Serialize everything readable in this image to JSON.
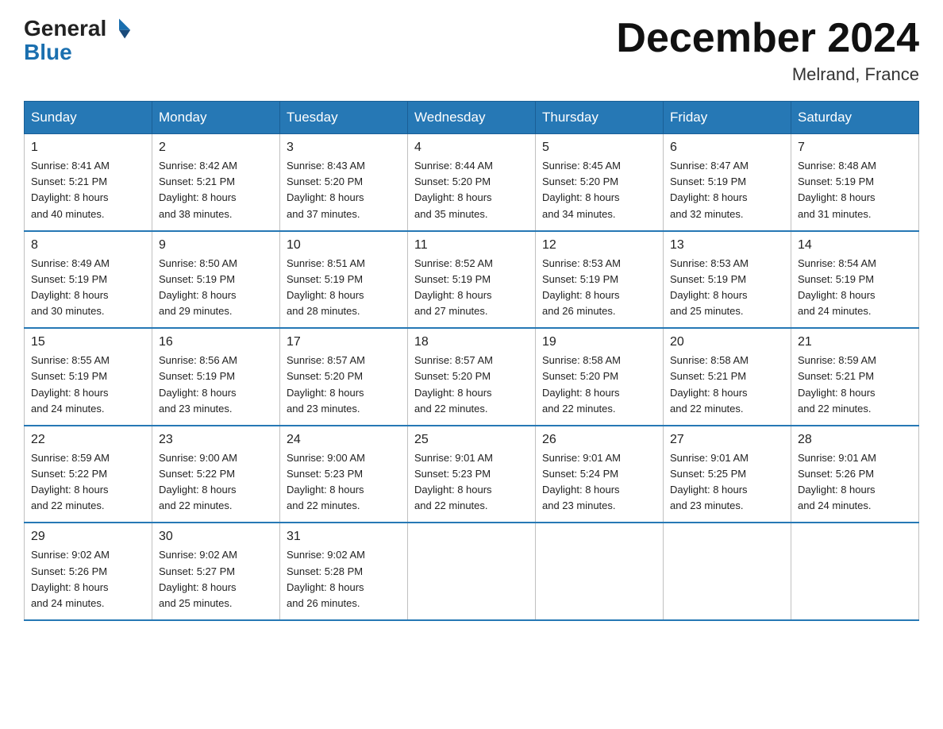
{
  "logo": {
    "general": "General",
    "blue": "Blue"
  },
  "title": "December 2024",
  "location": "Melrand, France",
  "days_of_week": [
    "Sunday",
    "Monday",
    "Tuesday",
    "Wednesday",
    "Thursday",
    "Friday",
    "Saturday"
  ],
  "weeks": [
    [
      {
        "day": "1",
        "info": "Sunrise: 8:41 AM\nSunset: 5:21 PM\nDaylight: 8 hours\nand 40 minutes."
      },
      {
        "day": "2",
        "info": "Sunrise: 8:42 AM\nSunset: 5:21 PM\nDaylight: 8 hours\nand 38 minutes."
      },
      {
        "day": "3",
        "info": "Sunrise: 8:43 AM\nSunset: 5:20 PM\nDaylight: 8 hours\nand 37 minutes."
      },
      {
        "day": "4",
        "info": "Sunrise: 8:44 AM\nSunset: 5:20 PM\nDaylight: 8 hours\nand 35 minutes."
      },
      {
        "day": "5",
        "info": "Sunrise: 8:45 AM\nSunset: 5:20 PM\nDaylight: 8 hours\nand 34 minutes."
      },
      {
        "day": "6",
        "info": "Sunrise: 8:47 AM\nSunset: 5:19 PM\nDaylight: 8 hours\nand 32 minutes."
      },
      {
        "day": "7",
        "info": "Sunrise: 8:48 AM\nSunset: 5:19 PM\nDaylight: 8 hours\nand 31 minutes."
      }
    ],
    [
      {
        "day": "8",
        "info": "Sunrise: 8:49 AM\nSunset: 5:19 PM\nDaylight: 8 hours\nand 30 minutes."
      },
      {
        "day": "9",
        "info": "Sunrise: 8:50 AM\nSunset: 5:19 PM\nDaylight: 8 hours\nand 29 minutes."
      },
      {
        "day": "10",
        "info": "Sunrise: 8:51 AM\nSunset: 5:19 PM\nDaylight: 8 hours\nand 28 minutes."
      },
      {
        "day": "11",
        "info": "Sunrise: 8:52 AM\nSunset: 5:19 PM\nDaylight: 8 hours\nand 27 minutes."
      },
      {
        "day": "12",
        "info": "Sunrise: 8:53 AM\nSunset: 5:19 PM\nDaylight: 8 hours\nand 26 minutes."
      },
      {
        "day": "13",
        "info": "Sunrise: 8:53 AM\nSunset: 5:19 PM\nDaylight: 8 hours\nand 25 minutes."
      },
      {
        "day": "14",
        "info": "Sunrise: 8:54 AM\nSunset: 5:19 PM\nDaylight: 8 hours\nand 24 minutes."
      }
    ],
    [
      {
        "day": "15",
        "info": "Sunrise: 8:55 AM\nSunset: 5:19 PM\nDaylight: 8 hours\nand 24 minutes."
      },
      {
        "day": "16",
        "info": "Sunrise: 8:56 AM\nSunset: 5:19 PM\nDaylight: 8 hours\nand 23 minutes."
      },
      {
        "day": "17",
        "info": "Sunrise: 8:57 AM\nSunset: 5:20 PM\nDaylight: 8 hours\nand 23 minutes."
      },
      {
        "day": "18",
        "info": "Sunrise: 8:57 AM\nSunset: 5:20 PM\nDaylight: 8 hours\nand 22 minutes."
      },
      {
        "day": "19",
        "info": "Sunrise: 8:58 AM\nSunset: 5:20 PM\nDaylight: 8 hours\nand 22 minutes."
      },
      {
        "day": "20",
        "info": "Sunrise: 8:58 AM\nSunset: 5:21 PM\nDaylight: 8 hours\nand 22 minutes."
      },
      {
        "day": "21",
        "info": "Sunrise: 8:59 AM\nSunset: 5:21 PM\nDaylight: 8 hours\nand 22 minutes."
      }
    ],
    [
      {
        "day": "22",
        "info": "Sunrise: 8:59 AM\nSunset: 5:22 PM\nDaylight: 8 hours\nand 22 minutes."
      },
      {
        "day": "23",
        "info": "Sunrise: 9:00 AM\nSunset: 5:22 PM\nDaylight: 8 hours\nand 22 minutes."
      },
      {
        "day": "24",
        "info": "Sunrise: 9:00 AM\nSunset: 5:23 PM\nDaylight: 8 hours\nand 22 minutes."
      },
      {
        "day": "25",
        "info": "Sunrise: 9:01 AM\nSunset: 5:23 PM\nDaylight: 8 hours\nand 22 minutes."
      },
      {
        "day": "26",
        "info": "Sunrise: 9:01 AM\nSunset: 5:24 PM\nDaylight: 8 hours\nand 23 minutes."
      },
      {
        "day": "27",
        "info": "Sunrise: 9:01 AM\nSunset: 5:25 PM\nDaylight: 8 hours\nand 23 minutes."
      },
      {
        "day": "28",
        "info": "Sunrise: 9:01 AM\nSunset: 5:26 PM\nDaylight: 8 hours\nand 24 minutes."
      }
    ],
    [
      {
        "day": "29",
        "info": "Sunrise: 9:02 AM\nSunset: 5:26 PM\nDaylight: 8 hours\nand 24 minutes."
      },
      {
        "day": "30",
        "info": "Sunrise: 9:02 AM\nSunset: 5:27 PM\nDaylight: 8 hours\nand 25 minutes."
      },
      {
        "day": "31",
        "info": "Sunrise: 9:02 AM\nSunset: 5:28 PM\nDaylight: 8 hours\nand 26 minutes."
      },
      {
        "day": "",
        "info": ""
      },
      {
        "day": "",
        "info": ""
      },
      {
        "day": "",
        "info": ""
      },
      {
        "day": "",
        "info": ""
      }
    ]
  ]
}
